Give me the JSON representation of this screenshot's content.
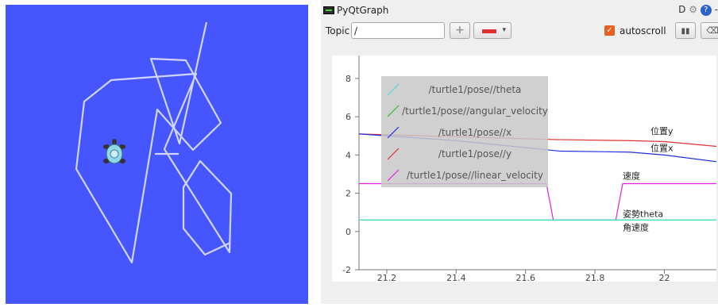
{
  "turtlesim": {
    "background": "#4556ff",
    "path_color": "#d0d4ff"
  },
  "rqt": {
    "app_title": "PyQtGraph",
    "title_tools": {
      "d_label": "D",
      "help_label": "?",
      "trail": "-"
    },
    "toolbar": {
      "topic_label": "Topic",
      "topic_value": "/",
      "add_label": "+",
      "color_caret": "▾",
      "autoscroll_label": "autoscroll",
      "autoscroll_checked": true,
      "pause_label": "▮▮",
      "clear_label": "⌫"
    },
    "colors": {
      "accent": "#e86020",
      "pen_swatch": "#e03030"
    }
  },
  "chart_data": {
    "type": "line",
    "title": "",
    "xlabel": "",
    "ylabel": "",
    "xlim": [
      21.12,
      22.15
    ],
    "ylim": [
      -2,
      9.2
    ],
    "xticks": [
      21.2,
      21.4,
      21.6,
      21.8,
      22
    ],
    "xtick_labels": [
      "21.2",
      "21.4",
      "21.6",
      "21.8",
      "22"
    ],
    "yticks": [
      -2,
      0,
      2,
      4,
      6,
      8
    ],
    "ytick_labels": [
      "-2",
      "0",
      "2",
      "4",
      "6",
      "8"
    ],
    "legend": {
      "placement": "top-left",
      "entries": [
        {
          "name": "/turtle1/pose//theta",
          "color": "#40e0d0"
        },
        {
          "name": "/turtle1/pose//angular_velocity",
          "color": "#30c030"
        },
        {
          "name": "/turtle1/pose//x",
          "color": "#2030e0"
        },
        {
          "name": "/turtle1/pose//y",
          "color": "#e03030"
        },
        {
          "name": "/turtle1/pose//linear_velocity",
          "color": "#e020e0"
        }
      ]
    },
    "series": [
      {
        "name": "/turtle1/pose//y",
        "color": "#e03030",
        "x": [
          21.12,
          21.4,
          21.7,
          21.9,
          22.0,
          22.15
        ],
        "y": [
          5.1,
          4.95,
          4.8,
          4.75,
          4.7,
          4.45
        ]
      },
      {
        "name": "/turtle1/pose//x",
        "color": "#2030e0",
        "x": [
          21.12,
          21.4,
          21.7,
          21.9,
          22.0,
          22.15
        ],
        "y": [
          5.1,
          4.75,
          4.2,
          4.15,
          4.0,
          3.65
        ]
      },
      {
        "name": "/turtle1/pose//linear_velocity",
        "color": "#e020e0",
        "x": [
          21.12,
          21.66,
          21.68,
          21.86,
          21.88,
          22.15
        ],
        "y": [
          2.5,
          2.5,
          0.6,
          0.6,
          2.5,
          2.5
        ]
      },
      {
        "name": "/turtle1/pose//angular_velocity",
        "color": "#30c030",
        "x": [
          21.12,
          22.15
        ],
        "y": [
          0.6,
          0.6
        ]
      },
      {
        "name": "/turtle1/pose//theta",
        "color": "#40e0d0",
        "x": [
          21.12,
          22.15
        ],
        "y": [
          0.6,
          0.6
        ]
      }
    ],
    "annotations": [
      {
        "text": "位置y",
        "x": 21.96,
        "y": 5.1
      },
      {
        "text": "位置x",
        "x": 21.96,
        "y": 4.2
      },
      {
        "text": "速度",
        "x": 21.88,
        "y": 2.75
      },
      {
        "text": "姿勢theta",
        "x": 21.88,
        "y": 0.75
      },
      {
        "text": "角速度",
        "x": 21.88,
        "y": 0.05
      }
    ]
  }
}
